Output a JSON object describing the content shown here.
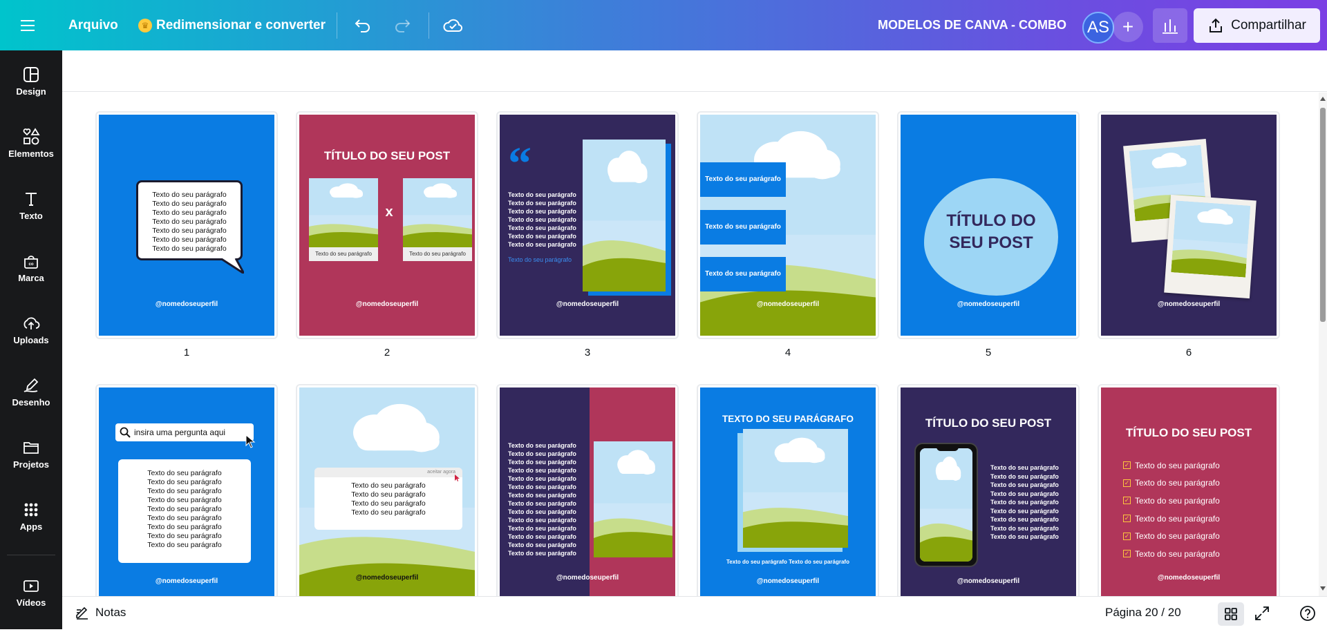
{
  "topbar": {
    "menu_icon": "hamburger-icon",
    "file_label": "Arquivo",
    "resize_label": "Redimensionar e converter",
    "project_title": "MODELOS DE CANVA - COMBO",
    "avatar_initials": "AS",
    "share_label": "Compartilhar"
  },
  "sidebar": {
    "items": [
      {
        "label": "Design",
        "icon": "design-icon"
      },
      {
        "label": "Elementos",
        "icon": "elements-icon"
      },
      {
        "label": "Texto",
        "icon": "text-icon"
      },
      {
        "label": "Marca",
        "icon": "brand-icon"
      },
      {
        "label": "Uploads",
        "icon": "upload-icon"
      },
      {
        "label": "Desenho",
        "icon": "draw-icon"
      },
      {
        "label": "Projetos",
        "icon": "folder-icon"
      },
      {
        "label": "Apps",
        "icon": "apps-icon"
      },
      {
        "label": "Vídeos",
        "icon": "video-icon"
      }
    ]
  },
  "pages": {
    "numbers": [
      "1",
      "2",
      "3",
      "4",
      "5",
      "6"
    ],
    "handle": "@nomedoseuperfil",
    "paragraph": "Texto do seu parágrafo",
    "title": "TÍTULO DO SEU POST",
    "title_line1": "TÍTULO DO",
    "title_line2": "SEU POST",
    "x_mark": "x",
    "search_placeholder": "insira uma pergunta aqui",
    "accept_now": "aceitar agora",
    "paragraph_upper": "TEXTO DO SEU PARÁGRAFO",
    "paragraph_double": "Texto do seu parágrafo Texto do seu parágrafo"
  },
  "bottombar": {
    "notes_label": "Notas",
    "page_indicator": "Página 20 / 20"
  },
  "colors": {
    "blue": "#0a7ce3",
    "crimson": "#b0365a",
    "navy": "#33285c"
  }
}
